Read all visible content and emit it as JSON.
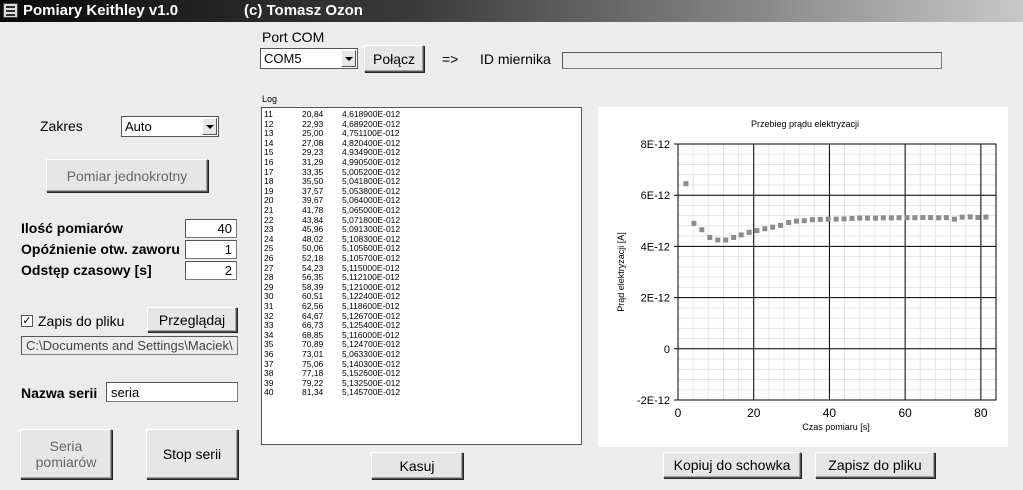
{
  "window": {
    "title": "Pomiary Keithley v1.0",
    "author": "(c) Tomasz Ozon"
  },
  "port": {
    "label": "Port COM",
    "value": "COM5",
    "connect_label": "Połącz",
    "arrow": "=>",
    "id_label": "ID miernika",
    "id_value": ""
  },
  "left": {
    "range_label": "Zakres",
    "range_value": "Auto",
    "single_button": "Pomiar jednokrotny",
    "count_label": "Ilość pomiarów",
    "count_value": "40",
    "delay_label": "Opóźnienie otw. zaworu",
    "delay_value": "1",
    "interval_label": "Odstęp czasowy [s]",
    "interval_value": "2",
    "save_check": "✓",
    "save_label": "Zapis do pliku",
    "browse_button": "Przeglądaj",
    "path_value": "C:\\Documents and Settings\\Maciek\\",
    "series_label": "Nazwa serii",
    "series_value": "seria",
    "series_button": "Seria\npomiarów",
    "stop_button": "Stop serii"
  },
  "log": {
    "label": "Log",
    "clear_button": "Kasuj",
    "rows": [
      [
        "11",
        "20,84",
        "4,618900E-012"
      ],
      [
        "12",
        "22,93",
        "4,689200E-012"
      ],
      [
        "13",
        "25,00",
        "4,751100E-012"
      ],
      [
        "14",
        "27,08",
        "4,820400E-012"
      ],
      [
        "15",
        "29,23",
        "4,934900E-012"
      ],
      [
        "16",
        "31,29",
        "4,990500E-012"
      ],
      [
        "17",
        "33,35",
        "5,005200E-012"
      ],
      [
        "18",
        "35,50",
        "5,041800E-012"
      ],
      [
        "19",
        "37,57",
        "5,053800E-012"
      ],
      [
        "20",
        "39,67",
        "5,064000E-012"
      ],
      [
        "21",
        "41,78",
        "5,065000E-012"
      ],
      [
        "22",
        "43,84",
        "5,071800E-012"
      ],
      [
        "23",
        "45,96",
        "5,091300E-012"
      ],
      [
        "24",
        "48,02",
        "5,108300E-012"
      ],
      [
        "25",
        "50,06",
        "5,105600E-012"
      ],
      [
        "26",
        "52,18",
        "5,105700E-012"
      ],
      [
        "27",
        "54,23",
        "5,115000E-012"
      ],
      [
        "28",
        "56,35",
        "5,112100E-012"
      ],
      [
        "29",
        "58,39",
        "5,121000E-012"
      ],
      [
        "30",
        "60,51",
        "5,122400E-012"
      ],
      [
        "31",
        "62,56",
        "5,118600E-012"
      ],
      [
        "32",
        "64,67",
        "5,126700E-012"
      ],
      [
        "33",
        "66,73",
        "5,125400E-012"
      ],
      [
        "34",
        "68,85",
        "5,116000E-012"
      ],
      [
        "35",
        "70,89",
        "5,124700E-012"
      ],
      [
        "36",
        "73,01",
        "5,063300E-012"
      ],
      [
        "37",
        "75,06",
        "5,140300E-012"
      ],
      [
        "38",
        "77,18",
        "5,152600E-012"
      ],
      [
        "39",
        "79,22",
        "5,132500E-012"
      ],
      [
        "40",
        "81,34",
        "5,145700E-012"
      ]
    ]
  },
  "chart_buttons": {
    "copy": "Kopiuj do schowka",
    "save": "Zapisz do pliku"
  },
  "chart_data": {
    "type": "scatter",
    "title": "Przebieg prądu elektryzacji",
    "xlabel": "Czas pomiaru [s]",
    "ylabel": "Prąd elektryzacji [A]",
    "xlim": [
      0,
      84
    ],
    "ylim": [
      -2e-12,
      8e-12
    ],
    "xticks": [
      "0",
      "20",
      "40",
      "60",
      "80"
    ],
    "yticks": [
      "-2E-12",
      "0",
      "2E-12",
      "4E-12",
      "6E-12",
      "8E-12"
    ],
    "grid": true,
    "marker_color": "#8c8c8c",
    "x": [
      2.1,
      4.2,
      6.3,
      8.4,
      10.5,
      12.6,
      14.7,
      16.7,
      18.8,
      20.84,
      22.93,
      25.0,
      27.08,
      29.23,
      31.29,
      33.35,
      35.5,
      37.57,
      39.67,
      41.78,
      43.84,
      45.96,
      48.02,
      50.06,
      52.18,
      54.23,
      56.35,
      58.39,
      60.51,
      62.56,
      64.67,
      66.73,
      68.85,
      70.89,
      73.01,
      75.06,
      77.18,
      79.22,
      81.34
    ],
    "y": [
      6.45e-12,
      4.9e-12,
      4.65e-12,
      4.35e-12,
      4.25e-12,
      4.25e-12,
      4.35e-12,
      4.45e-12,
      4.55e-12,
      4.6189e-12,
      4.6892e-12,
      4.7511e-12,
      4.8204e-12,
      4.9349e-12,
      4.9905e-12,
      5.0052e-12,
      5.0418e-12,
      5.0538e-12,
      5.064e-12,
      5.065e-12,
      5.0718e-12,
      5.0913e-12,
      5.1083e-12,
      5.1056e-12,
      5.1057e-12,
      5.115e-12,
      5.1121e-12,
      5.121e-12,
      5.1224e-12,
      5.1186e-12,
      5.1267e-12,
      5.1254e-12,
      5.116e-12,
      5.1247e-12,
      5.0633e-12,
      5.1403e-12,
      5.1526e-12,
      5.1325e-12,
      5.1457e-12
    ]
  }
}
